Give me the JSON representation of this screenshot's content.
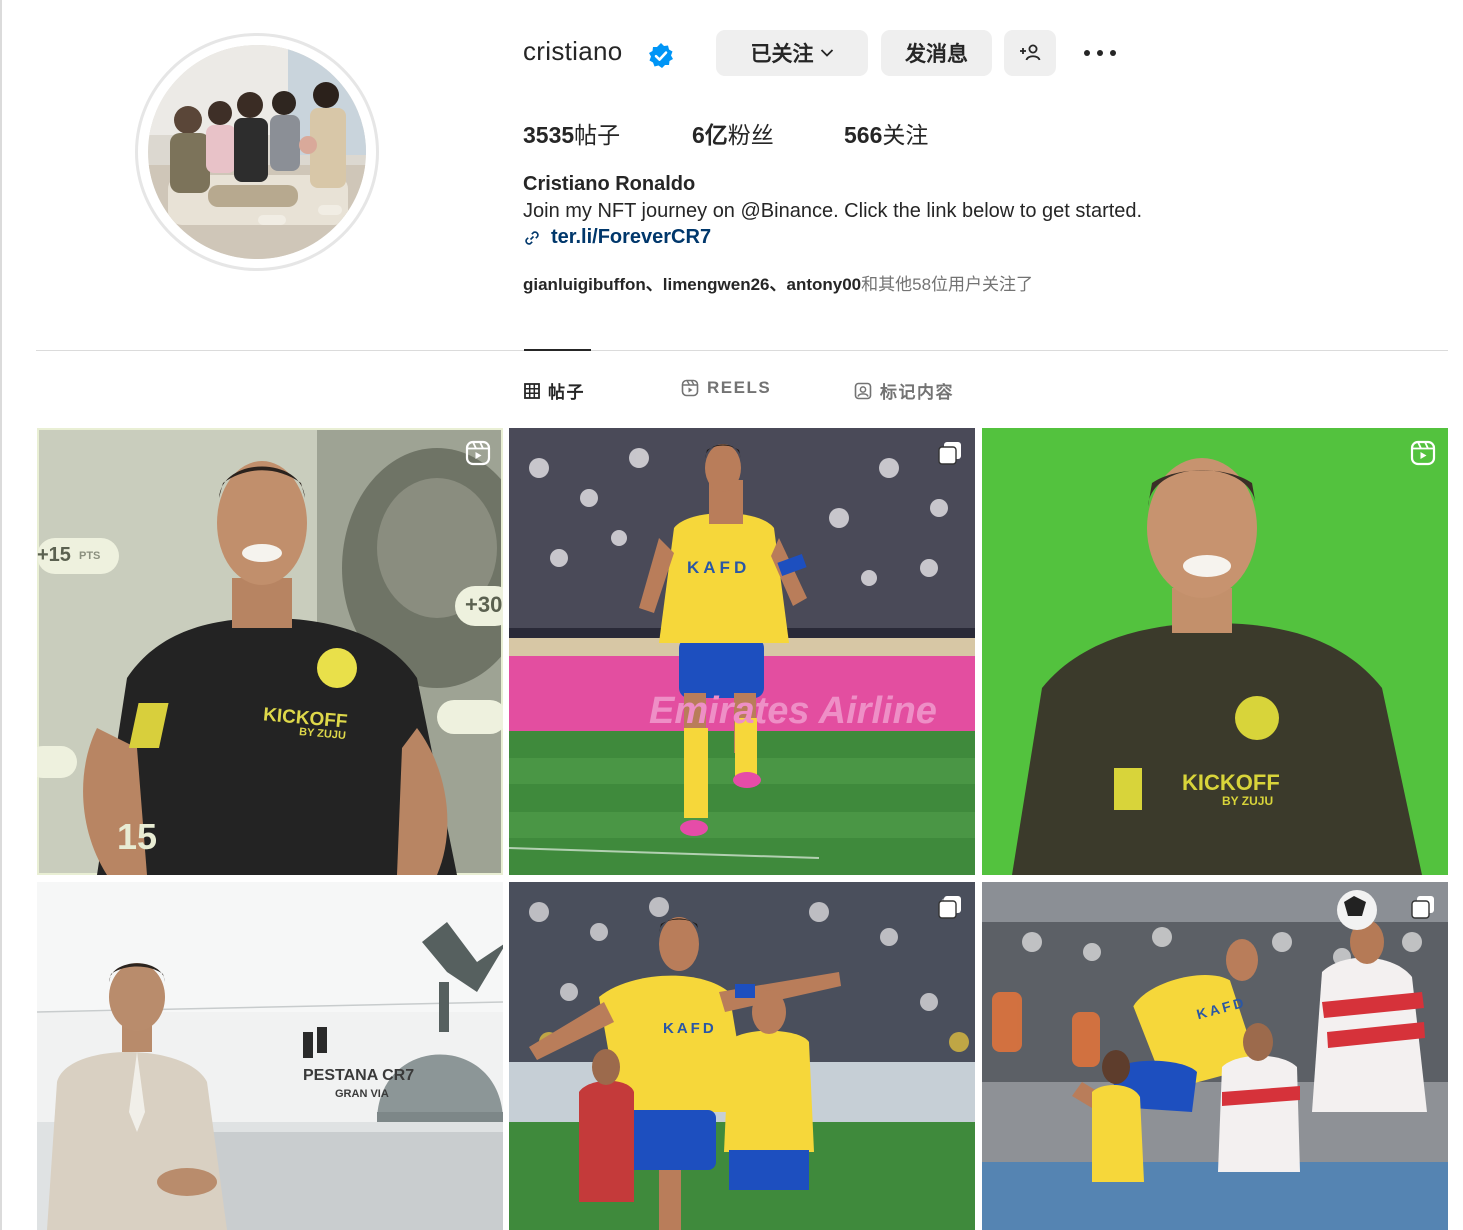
{
  "profile": {
    "username": "cristiano",
    "verified": true,
    "buttons": {
      "following": "已关注",
      "message": "发消息"
    },
    "stats": {
      "posts_count": "3535",
      "posts_label": "帖子",
      "followers_count": "6亿",
      "followers_label": "粉丝",
      "following_count": "566",
      "following_label": "关注"
    },
    "full_name": "Cristiano Ronaldo",
    "bio": "Join my NFT journey on @Binance. Click the link below to get started.",
    "link": "ter.li/ForeverCR7",
    "followed_by": {
      "users": "gianluigibuffon、limengwen26、antony00",
      "suffix": "和其他58位用户关注了"
    }
  },
  "tabs": [
    {
      "label": "帖子",
      "icon": "grid-icon",
      "active": true
    },
    {
      "label": "REELS",
      "icon": "reels-icon",
      "active": false
    },
    {
      "label": "标记内容",
      "icon": "tagged-icon",
      "active": false
    }
  ],
  "posts": [
    {
      "type": "reel",
      "icon": "reel-badge-icon",
      "texts": {
        "pts1": "+15",
        "pts_label": "PTS",
        "pts2": "+30",
        "brand": "KICKOFF",
        "brand_sub": "BY ZUJU",
        "big": "15"
      }
    },
    {
      "type": "carousel",
      "icon": "carousel-badge-icon",
      "texts": {
        "shirt": "KAFD",
        "banner": "Emirates Airline"
      }
    },
    {
      "type": "reel",
      "icon": "reel-badge-icon",
      "texts": {
        "brand": "KICKOFF",
        "brand_sub": "BY ZUJU"
      }
    },
    {
      "type": "photo",
      "texts": {
        "sign": "PESTANA CR7",
        "sign_sub": "GRAN VIA"
      }
    },
    {
      "type": "carousel",
      "icon": "carousel-badge-icon",
      "texts": {
        "shirt": "KAFD"
      }
    },
    {
      "type": "carousel",
      "icon": "carousel-badge-icon",
      "texts": {
        "shirt": "KAFD"
      }
    }
  ],
  "colors": {
    "text": "#262626",
    "muted": "#737373",
    "link": "#00376b",
    "verified_blue": "#0095f6",
    "button_bg": "#efefef",
    "al_nassr_yellow": "#f6d73a",
    "al_nassr_blue": "#1d4fbf",
    "green_screen": "#4fbf3a",
    "pitch_green": "#3f8a3c"
  }
}
